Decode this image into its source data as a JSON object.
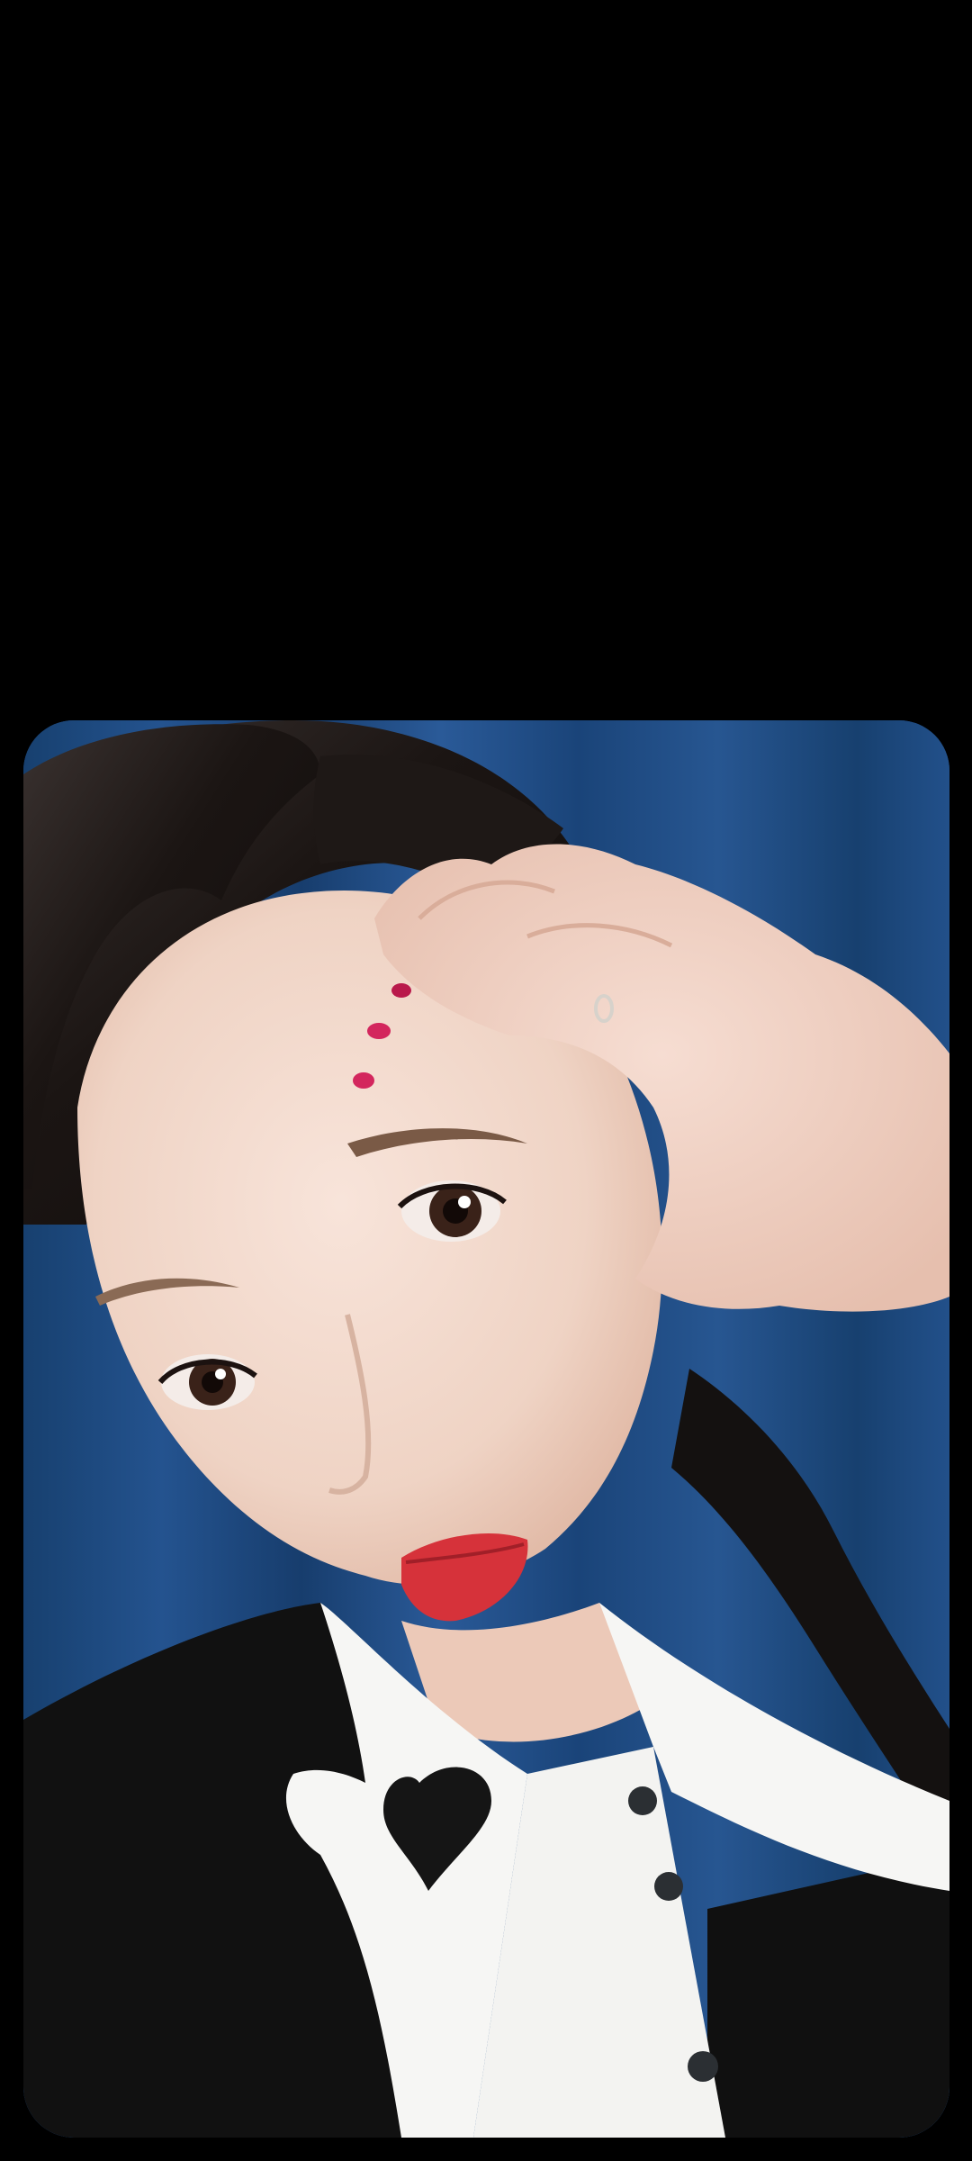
{
  "screen": {
    "background": "#000000"
  },
  "photo": {
    "subject": "selfie-portrait",
    "backdrop_color": "#1d4a86",
    "hair_color": "#1a1614",
    "skin_color": "#f1d9cc",
    "lip_color": "#d6323a",
    "jacket_color": "#111111",
    "shirt_color": "#f6f6f4"
  }
}
